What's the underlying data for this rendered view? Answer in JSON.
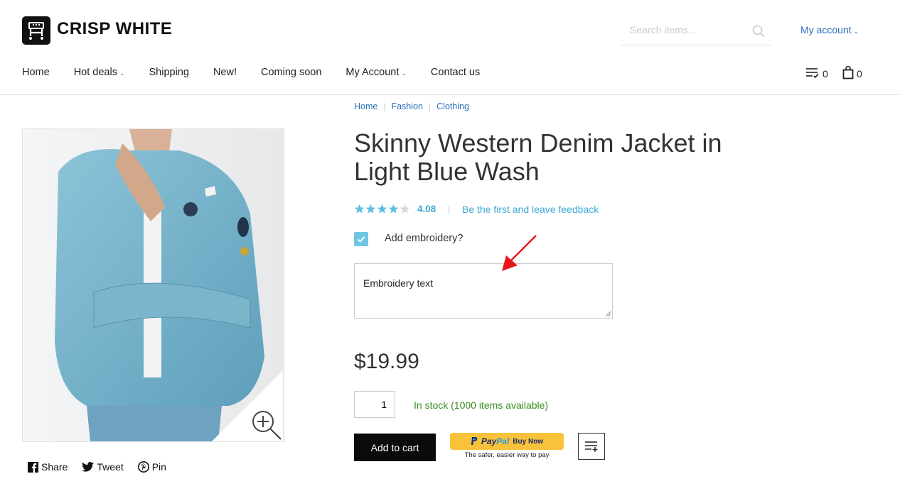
{
  "header": {
    "logo_text": "CRISP WHITE",
    "search_placeholder": "Search items...",
    "account_label": "My account",
    "compare_count": "0",
    "cart_count": "0"
  },
  "nav": {
    "items": [
      {
        "label": "Home",
        "dropdown": false
      },
      {
        "label": "Hot deals",
        "dropdown": true
      },
      {
        "label": "Shipping",
        "dropdown": false
      },
      {
        "label": "New!",
        "dropdown": false
      },
      {
        "label": "Coming soon",
        "dropdown": false
      },
      {
        "label": "My Account",
        "dropdown": true
      },
      {
        "label": "Contact us",
        "dropdown": false
      }
    ]
  },
  "breadcrumbs": [
    "Home",
    "Fashion",
    "Clothing"
  ],
  "product": {
    "title": "Skinny Western Denim Jacket in Light Blue Wash",
    "rating": "4.08",
    "rating_fraction": 0.816,
    "feedback_link": "Be the first and leave feedback",
    "embroidery_label": "Add embroidery?",
    "embroidery_checked": true,
    "embroidery_value": "Embroidery text",
    "price": "$19.99",
    "quantity": "1",
    "stock": "In stock (1000 items available)",
    "add_to_cart": "Add to cart",
    "paypal_pay": "Pay",
    "paypal_pal": "Pal",
    "paypal_buy": "Buy Now",
    "paypal_tagline": "The safer, easier way to pay"
  },
  "share": {
    "facebook": "Share",
    "twitter": "Tweet",
    "pinterest": "Pin"
  },
  "colors": {
    "link_blue": "#2a6ebd",
    "accent_cyan": "#3ea9d5",
    "stock_green": "#3a8a1e",
    "star_color": "#5cc0e0",
    "annotation_red": "#e8161b"
  }
}
